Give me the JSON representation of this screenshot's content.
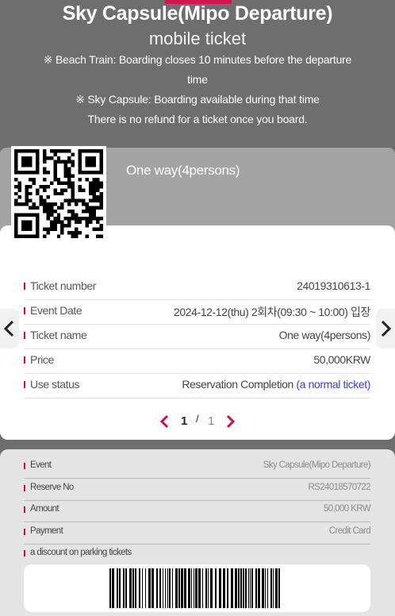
{
  "header": {
    "title": "Sky Capsule(Mipo Departure)",
    "subtitle": "mobile ticket",
    "notice_1": "※ Beach Train: Boarding closes 10 minutes before the departure time",
    "notice_2": "※ Sky Capsule: Boarding available during that time",
    "notice_3": "There is no refund for a ticket once you board."
  },
  "colors": {
    "accent": "#d8114f",
    "background": "#6e6e6e",
    "status_link": "#3d3dd0"
  },
  "ticket": {
    "type": "One way(4persons)",
    "rows": [
      {
        "label": "Ticket number",
        "value": "24019310613-1"
      },
      {
        "label": "Event Date",
        "value": "2024-12-12(thu) 2회차(09:30 ~ 10:00) 입장"
      },
      {
        "label": "Ticket name",
        "value": "One way(4persons)"
      },
      {
        "label": "Price",
        "value": "50,000KRW"
      },
      {
        "label": "Use status",
        "value": "Reservation Completion",
        "note": "(a normal ticket)"
      }
    ]
  },
  "pagination": {
    "current": "1",
    "separator": "/",
    "total": "1"
  },
  "details": [
    {
      "label": "Event",
      "value": "Sky Capsule(Mipo Departure)"
    },
    {
      "label": "Reserve No",
      "value": "RS24018570722"
    },
    {
      "label": "Amount",
      "value": "50,000 KRW"
    },
    {
      "label": "Payment",
      "value": "Credit Card"
    },
    {
      "label": "a discount on parking tickets",
      "value": ""
    }
  ],
  "icons": {
    "qr": "qr-code-icon",
    "barcode": "barcode-icon",
    "prev": "chevron-left-icon",
    "next": "chevron-right-icon"
  }
}
